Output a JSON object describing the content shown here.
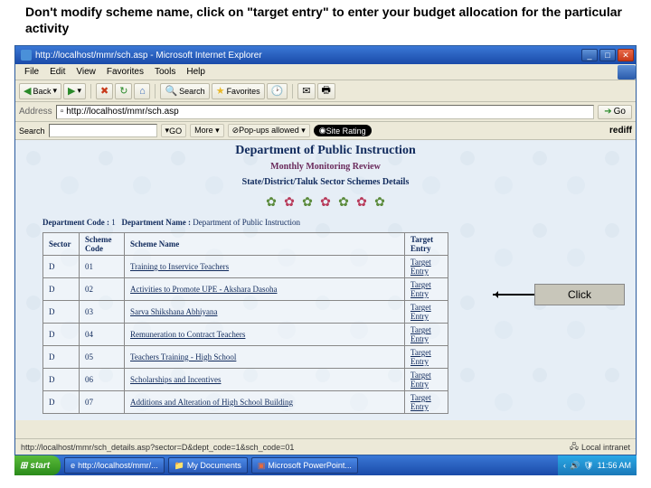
{
  "instruction": "Don't modify scheme name, click on \"target entry\" to enter your budget allocation for the particular activity",
  "titlebar": {
    "title": "http://localhost/mmr/sch.asp - Microsoft Internet Explorer"
  },
  "menubar": {
    "file": "File",
    "edit": "Edit",
    "view": "View",
    "favorites": "Favorites",
    "tools": "Tools",
    "help": "Help"
  },
  "toolbar1": {
    "back": "Back",
    "search": "Search",
    "favorites": "Favorites"
  },
  "addressbar": {
    "label": "Address",
    "url": "http://localhost/mmr/sch.asp",
    "go": "Go"
  },
  "toolbar2": {
    "search": "Search",
    "go": "GO",
    "more": "More ▾",
    "popups": "Pop-ups allowed ▾",
    "siterating": "Site Rating",
    "rediff": "rediff"
  },
  "page": {
    "title": "Department of Public Instruction",
    "subtitle": "Monthly Monitoring Review",
    "heading": "State/District/Taluk Sector Schemes Details",
    "dept_code_label": "Department Code :",
    "dept_code": "1",
    "dept_name_label": "Department Name :",
    "dept_name": "Department of Public Instruction"
  },
  "table": {
    "headers": {
      "sector": "Sector",
      "code": "Scheme Code",
      "name": "Scheme Name",
      "entry": "Target Entry"
    },
    "rows": [
      {
        "sector": "D",
        "code": "01",
        "name": "Training to Inservice Teachers",
        "entry": "Target Entry"
      },
      {
        "sector": "D",
        "code": "02",
        "name": "Activities to Promote UPE - Akshara Dasoha",
        "entry": "Target Entry"
      },
      {
        "sector": "D",
        "code": "03",
        "name": "Sarva Shikshana Abhiyana",
        "entry": "Target Entry"
      },
      {
        "sector": "D",
        "code": "04",
        "name": "Remuneration to Contract Teachers",
        "entry": "Target Entry"
      },
      {
        "sector": "D",
        "code": "05",
        "name": "Teachers Training - High School",
        "entry": "Target Entry"
      },
      {
        "sector": "D",
        "code": "06",
        "name": "Scholarships and Incentives",
        "entry": "Target Entry"
      },
      {
        "sector": "D",
        "code": "07",
        "name": "Additions and Alteration of High School Building",
        "entry": "Target Entry"
      }
    ]
  },
  "callout": {
    "label": "Click"
  },
  "statusbar": {
    "left": "http://localhost/mmr/sch_details.asp?sector=D&dept_code=1&sch_code=01",
    "right": "Local intranet"
  },
  "taskbar": {
    "start": "start",
    "items": [
      "http://localhost/mmr/...",
      "My Documents",
      "Microsoft PowerPoint..."
    ],
    "time": "11:56 AM"
  }
}
